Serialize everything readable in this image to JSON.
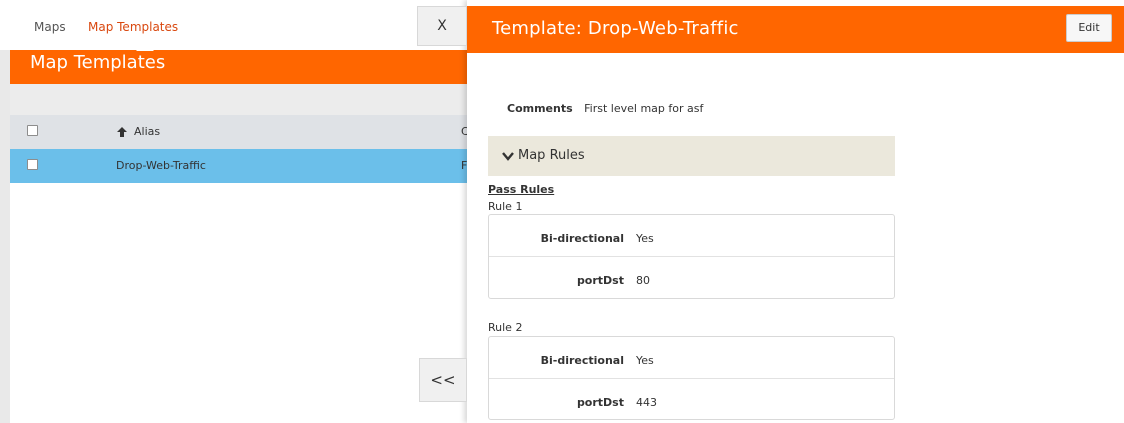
{
  "tabs": {
    "maps": "Maps",
    "map_templates": "Map Templates"
  },
  "left_panel": {
    "banner_title": "Map Templates",
    "table": {
      "header": {
        "alias": "Alias",
        "next_col": "C"
      },
      "rows": [
        {
          "alias": "Drop-Web-Traffic",
          "next_col": "F"
        }
      ]
    }
  },
  "buttons": {
    "close": "X",
    "collapse": "<<",
    "edit": "Edit"
  },
  "detail": {
    "title": "Template: Drop-Web-Traffic",
    "comments_label": "Comments",
    "comments_value": "First level map for asf",
    "map_rules_label": "Map Rules",
    "pass_rules_label": "Pass Rules",
    "rules": [
      {
        "label": "Rule 1",
        "bidir_key": "Bi-directional",
        "bidir_val": "Yes",
        "port_key": "portDst",
        "port_val": "80"
      },
      {
        "label": "Rule 2",
        "bidir_key": "Bi-directional",
        "bidir_val": "Yes",
        "port_key": "portDst",
        "port_val": "443"
      }
    ]
  },
  "colors": {
    "brand_orange": "#ff6600",
    "selected_row": "#6bbfea",
    "active_tab": "#d9480f",
    "section_bar": "#ebe8dc"
  },
  "icons": {
    "sort": "arrow-up-icon",
    "section": "chevron-down-icon"
  }
}
